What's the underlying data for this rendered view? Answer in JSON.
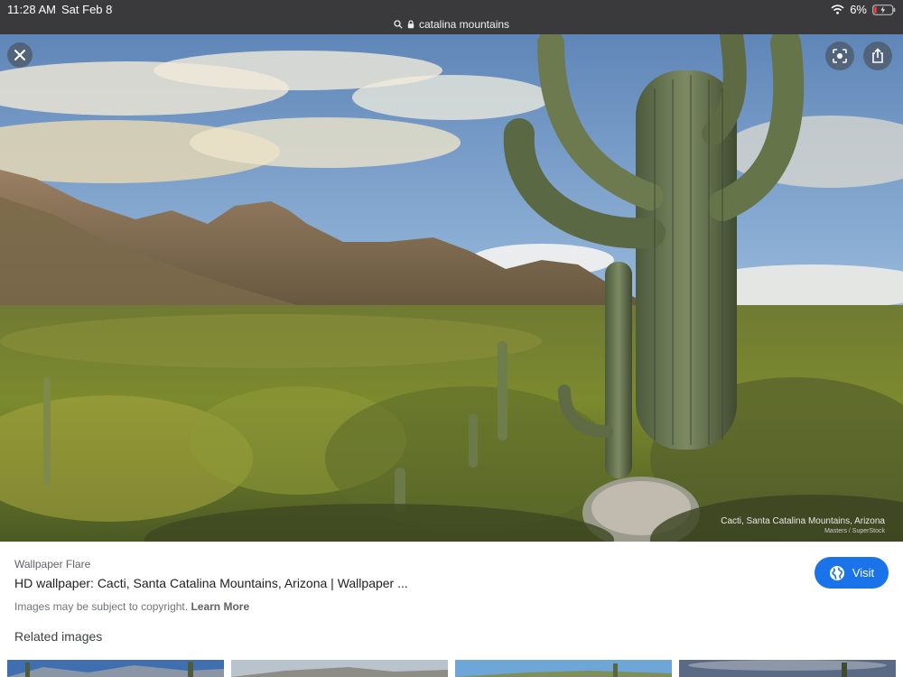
{
  "status": {
    "time": "11:28 AM",
    "date": "Sat Feb 8",
    "battery": "6%"
  },
  "url": {
    "text": "catalina mountains"
  },
  "hero": {
    "caption": "Cacti, Santa Catalina Mountains, Arizona",
    "credit": "Masters / SuperStock"
  },
  "result": {
    "source": "Wallpaper Flare",
    "title": "HD wallpaper: Cacti, Santa Catalina Mountains, Arizona | Wallpaper ...",
    "copyright": "Images may be subject to copyright.",
    "learn_more": "Learn More",
    "visit_label": "Visit"
  },
  "related": {
    "heading": "Related images"
  },
  "icons": {
    "close": "close-icon",
    "lens": "lens-icon",
    "share": "share-icon",
    "globe": "globe-icon",
    "search": "search-icon",
    "lock": "lock-icon",
    "wifi": "wifi-icon",
    "battery": "battery-icon"
  },
  "colors": {
    "accent": "#1a73e8",
    "topbar": "#3a3a3c"
  }
}
